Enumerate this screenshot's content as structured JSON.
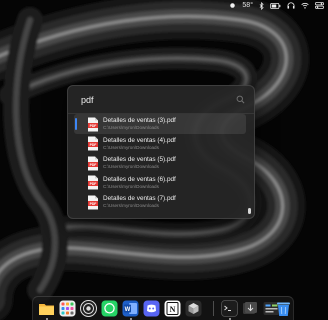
{
  "menubar": {
    "temperature": "58°"
  },
  "spotlight": {
    "query": "pdf",
    "results": [
      {
        "title": "Detalles de ventas (3).pdf",
        "path": "C:\\Users\\myron\\Downloads",
        "selected": true
      },
      {
        "title": "Detalles de ventas (4).pdf",
        "path": "C:\\Users\\myron\\Downloads",
        "selected": false
      },
      {
        "title": "Detalles de ventas (5).pdf",
        "path": "C:\\Users\\myron\\Downloads",
        "selected": false
      },
      {
        "title": "Detalles de ventas (6).pdf",
        "path": "C:\\Users\\myron\\Downloads",
        "selected": false
      },
      {
        "title": "Detalles de ventas (7).pdf",
        "path": "C:\\Users\\myron\\Downloads",
        "selected": false
      }
    ]
  },
  "dock": {
    "apps": [
      {
        "name": "folder-icon"
      },
      {
        "name": "launchpad-icon"
      },
      {
        "name": "obs-icon"
      },
      {
        "name": "whatsapp-icon"
      },
      {
        "name": "word-icon"
      },
      {
        "name": "discord-icon"
      },
      {
        "name": "notion-icon"
      },
      {
        "name": "virtualbox-icon"
      },
      {
        "name": "terminal-icon"
      },
      {
        "name": "downloads-stack-icon"
      },
      {
        "name": "control-panel-icon"
      },
      {
        "name": "trash-icon"
      }
    ]
  },
  "colors": {
    "accent": "#3d86f5",
    "pdf_red": "#e53935",
    "panel": "#262626"
  }
}
